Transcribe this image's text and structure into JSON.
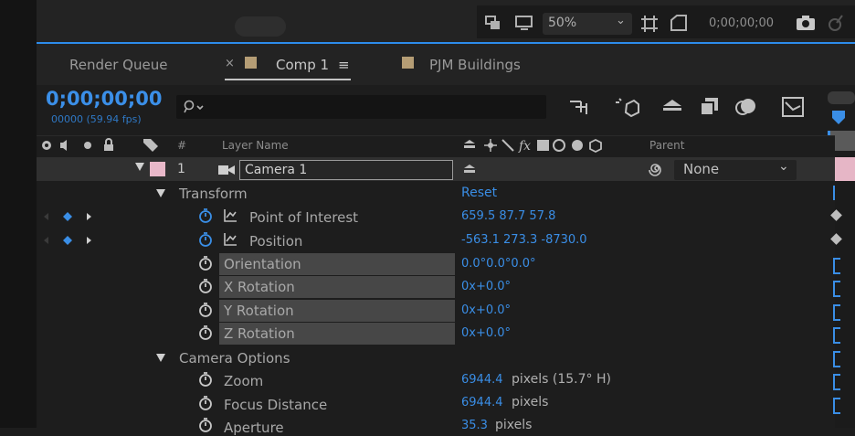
{
  "viewer": {
    "zoom": "50%",
    "timecode": "0;00;00;00"
  },
  "tabs": [
    {
      "label": "Render Queue"
    },
    {
      "label": "Comp 1",
      "close": "×",
      "menu": "≡"
    },
    {
      "label": "PJM Buildings"
    }
  ],
  "timeline": {
    "timecode": "0;00;00;00",
    "frames": "00000 (59.94 fps)",
    "search_placeholder": ""
  },
  "columns": {
    "num": "#",
    "layer_name": "Layer Name",
    "parent": "Parent"
  },
  "layer": {
    "index": "1",
    "name": "Camera 1",
    "parent": "None",
    "label_color": "#e9b8c9"
  },
  "transform": {
    "label": "Transform",
    "reset": "Reset"
  },
  "properties": [
    {
      "name": "Point of Interest",
      "value": "659.5 87.7 57.8",
      "keyframed": true
    },
    {
      "name": "Position",
      "value": "-563.1 273.3 -8730.0",
      "keyframed": true
    },
    {
      "name": "Orientation",
      "value": "0.0°0.0°0.0°"
    },
    {
      "name": "X Rotation",
      "value": "0x+0.0°"
    },
    {
      "name": "Y Rotation",
      "value": "0x+0.0°"
    },
    {
      "name": "Z Rotation",
      "value": "0x+0.0°"
    }
  ],
  "camera_options": {
    "label": "Camera Options",
    "zoom": "Zoom",
    "zoom_value": "6944.4",
    "zoom_unit": "pixels (15.7° H)",
    "focus": "Focus Distance",
    "focus_value": "6944.4",
    "focus_unit": "pixels",
    "aperture": "Aperture",
    "aperture_value": "35.3",
    "aperture_unit": "pixels"
  },
  "colors": {
    "accent": "#2d8ceb",
    "selection": "#474747"
  }
}
